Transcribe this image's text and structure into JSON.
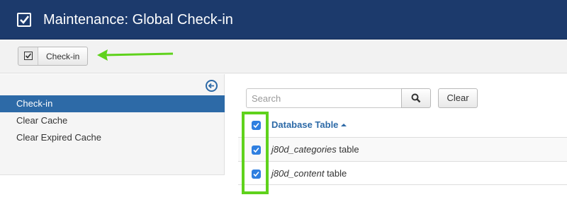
{
  "header": {
    "title": "Maintenance: Global Check-in",
    "icon": "checkbox-icon"
  },
  "toolbar": {
    "checkin_label": "Check-in",
    "checkin_icon": "checkbox-icon"
  },
  "sidebar": {
    "items": [
      {
        "label": "Check-in",
        "active": true
      },
      {
        "label": "Clear Cache",
        "active": false
      },
      {
        "label": "Clear Expired Cache",
        "active": false
      }
    ]
  },
  "filter": {
    "search_placeholder": "Search",
    "search_value": "",
    "clear_label": "Clear"
  },
  "table": {
    "column_header": "Database Table",
    "sort": "ascending",
    "rows": [
      {
        "name": "j80d_categories",
        "suffix": " table",
        "checked": true
      },
      {
        "name": "j80d_content",
        "suffix": " table",
        "checked": true
      }
    ],
    "select_all_checked": true
  },
  "colors": {
    "header_bg": "#1c3a6c",
    "accent": "#2d6aa7",
    "highlight": "#5fd21c",
    "checkbox": "#2f7fe0"
  }
}
